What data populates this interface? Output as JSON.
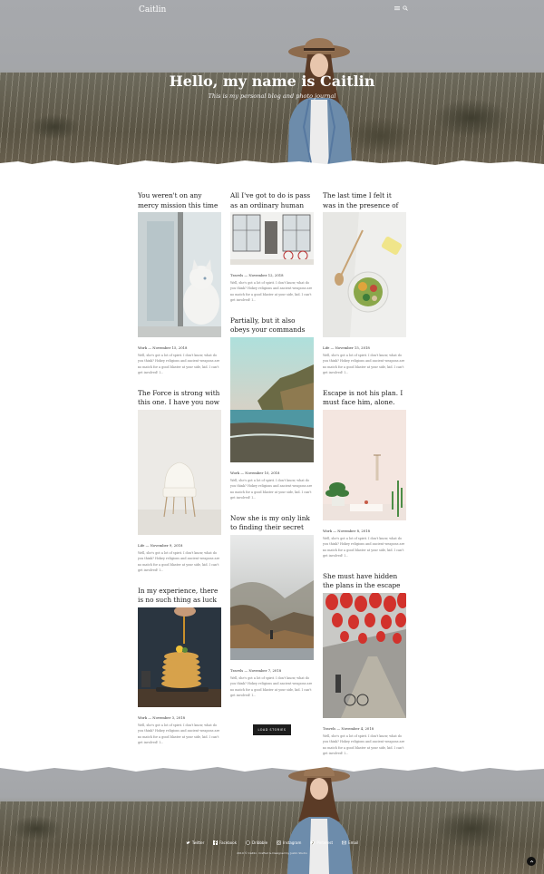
{
  "header": {
    "brand": "Caitlin",
    "menu_icon": "hamburger-icon",
    "search_icon": "search-icon",
    "hero_title": "Hello, my name is Caitlin",
    "hero_subtitle": "This is my personal blog and photo journal"
  },
  "columns": [
    [
      {
        "title": "You weren't on any mercy mission this time",
        "category": "Work",
        "date": "November 15, 2018",
        "image": "cat-at-window",
        "excerpt": "Well, she's got a lot of spirit. I don't know, what do you think? Hokey religions and ancient weapons are no match for a good blaster at your side, kid. I can't get involved! I..."
      },
      {
        "title": "The Force is strong with this one. I have you now",
        "category": "Life",
        "date": "November 9, 2018",
        "image": "white-chair",
        "excerpt": "Well, she's got a lot of spirit. I don't know, what do you think? Hokey religions and ancient weapons are no match for a good blaster at your side, kid. I can't get involved! I..."
      },
      {
        "title": "In my experience, there is no such thing as luck",
        "category": "Work",
        "date": "November 3, 2018",
        "image": "pancake-stack",
        "excerpt": "Well, she's got a lot of spirit. I don't know, what do you think? Hokey religions and ancient weapons are no match for a good blaster at your side, kid. I can't get involved! I..."
      }
    ],
    [
      {
        "title": "All I've got to do is pass as an ordinary human",
        "category": "Travels",
        "date": "November 12, 2018",
        "image": "bright-living-room",
        "excerpt": "Well, she's got a lot of spirit. I don't know, what do you think? Hokey religions and ancient weapons are no match for a good blaster at your side, kid. I can't get involved! I..."
      },
      {
        "title": "Partially, but it also obeys your commands",
        "category": "Work",
        "date": "November 10, 2018",
        "image": "coastal-cliffs",
        "excerpt": "Well, she's got a lot of spirit. I don't know, what do you think? Hokey religions and ancient weapons are no match for a good blaster at your side, kid. I can't get involved! I..."
      },
      {
        "title": "Now she is my only link to finding their secret base",
        "category": "Travels",
        "date": "November 7, 2018",
        "image": "misty-forest-road",
        "excerpt": "Well, she's got a lot of spirit. I don't know, what do you think? Hokey religions and ancient weapons are no match for a good blaster at your side, kid. I can't get involved! I..."
      }
    ],
    [
      {
        "title": "The last time I felt it was in the presence of my old master",
        "category": "Life",
        "date": "November 15, 2018",
        "image": "salad-bowl",
        "excerpt": "Well, she's got a lot of spirit. I don't know, what do you think? Hokey religions and ancient weapons are no match for a good blaster at your side, kid. I can't get involved! I..."
      },
      {
        "title": "Escape is not his plan. I must face him, alone.",
        "category": "Work",
        "date": "November 8, 2018",
        "image": "plants-pink-wall",
        "excerpt": "Well, she's got a lot of spirit. I don't know, what do you think? Hokey religions and ancient weapons are no match for a good blaster at your side, kid. I can't get involved! I..."
      },
      {
        "title": "She must have hidden the plans in the escape pod",
        "category": "Travels",
        "date": "November 4, 2018",
        "image": "red-lantern-street",
        "excerpt": "Well, she's got a lot of spirit. I don't know, what do you think? Hokey religions and ancient weapons are no match for a good blaster at your side, kid. I can't get involved! I..."
      }
    ]
  ],
  "load_more": "LOAD STORIES",
  "footer": {
    "social": [
      {
        "label": "Twitter",
        "icon": "twitter-icon"
      },
      {
        "label": "Facebook",
        "icon": "facebook-icon"
      },
      {
        "label": "Dribbble",
        "icon": "dribbble-icon"
      },
      {
        "label": "Instagram",
        "icon": "instagram-icon"
      },
      {
        "label": "Pinterest",
        "icon": "pinterest-icon"
      },
      {
        "label": "Email",
        "icon": "email-icon"
      }
    ],
    "copyright": "2019 © Caitlin. Crafted & Designed by Justin Studio",
    "scroll_top_icon": "arrow-up-icon"
  }
}
